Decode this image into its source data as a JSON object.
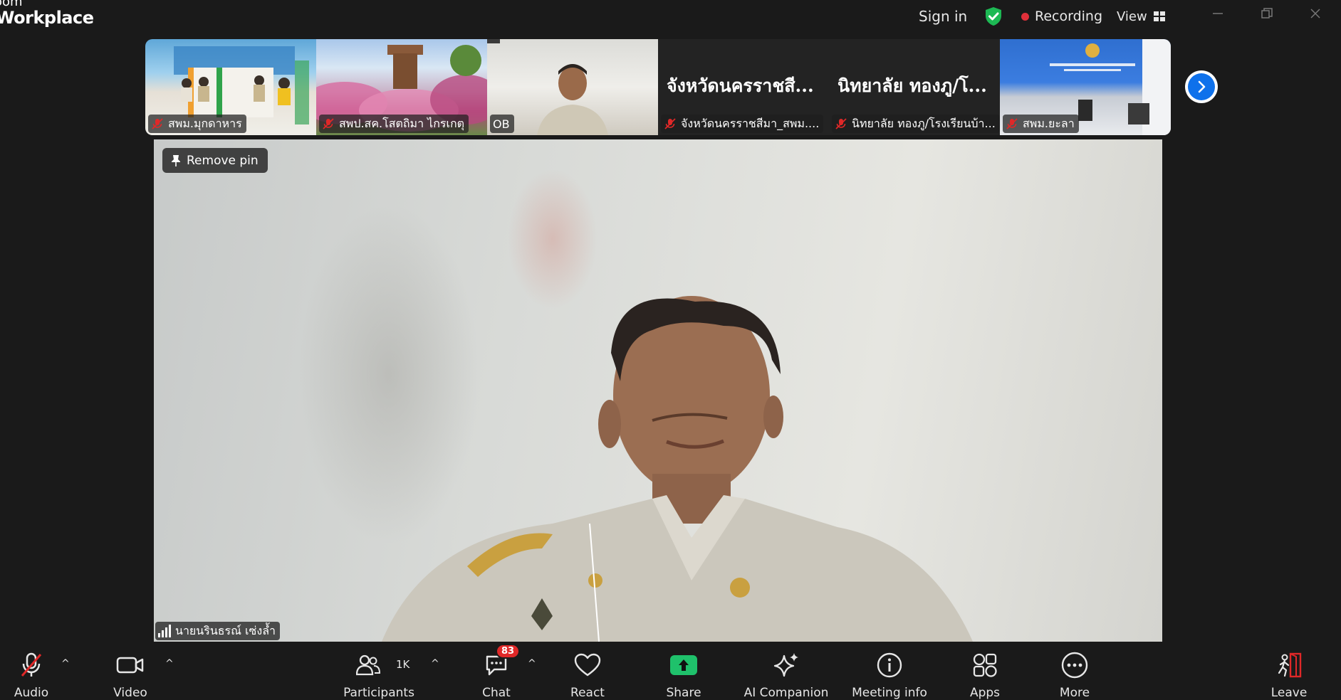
{
  "app": {
    "brand_line1": "oom",
    "brand_line2": "Workplace"
  },
  "titlebar": {
    "sign_in": "Sign in",
    "recording": "Recording",
    "view": "View"
  },
  "thumbnails": [
    {
      "name": "สพม.มุกดาหาร",
      "muted": true,
      "big_name": ""
    },
    {
      "name": "สพป.สค.โสตถิมา ไกรเกตุ",
      "muted": true,
      "big_name": ""
    },
    {
      "name": "OB",
      "muted": false,
      "big_name": ""
    },
    {
      "name": "จังหวัดนครราชสีมา_สพม....",
      "muted": true,
      "big_name": "จังหวัดนครราชสี..."
    },
    {
      "name": "นิทยาลัย ทองภู/โรงเรียนบ้า...",
      "muted": true,
      "big_name": "นิทยาลัย ทองภู/โ..."
    },
    {
      "name": "สพม.ยะลา",
      "muted": true,
      "big_name": ""
    }
  ],
  "main": {
    "remove_pin": "Remove pin",
    "speaker_name": "นายนรินธรณ์ เซ่งล้ำ"
  },
  "toolbar": {
    "audio": "Audio",
    "video": "Video",
    "participants": "Participants",
    "participants_count": "1K",
    "chat": "Chat",
    "chat_badge": "83",
    "react": "React",
    "share": "Share",
    "ai_companion": "AI Companion",
    "meeting_info": "Meeting info",
    "apps": "Apps",
    "more": "More",
    "leave": "Leave"
  },
  "colors": {
    "accent_blue": "#0e71eb",
    "share_green": "#1fc16b",
    "recording_red": "#e0303a",
    "shield_green": "#1db954",
    "badge_red": "#e02828"
  }
}
